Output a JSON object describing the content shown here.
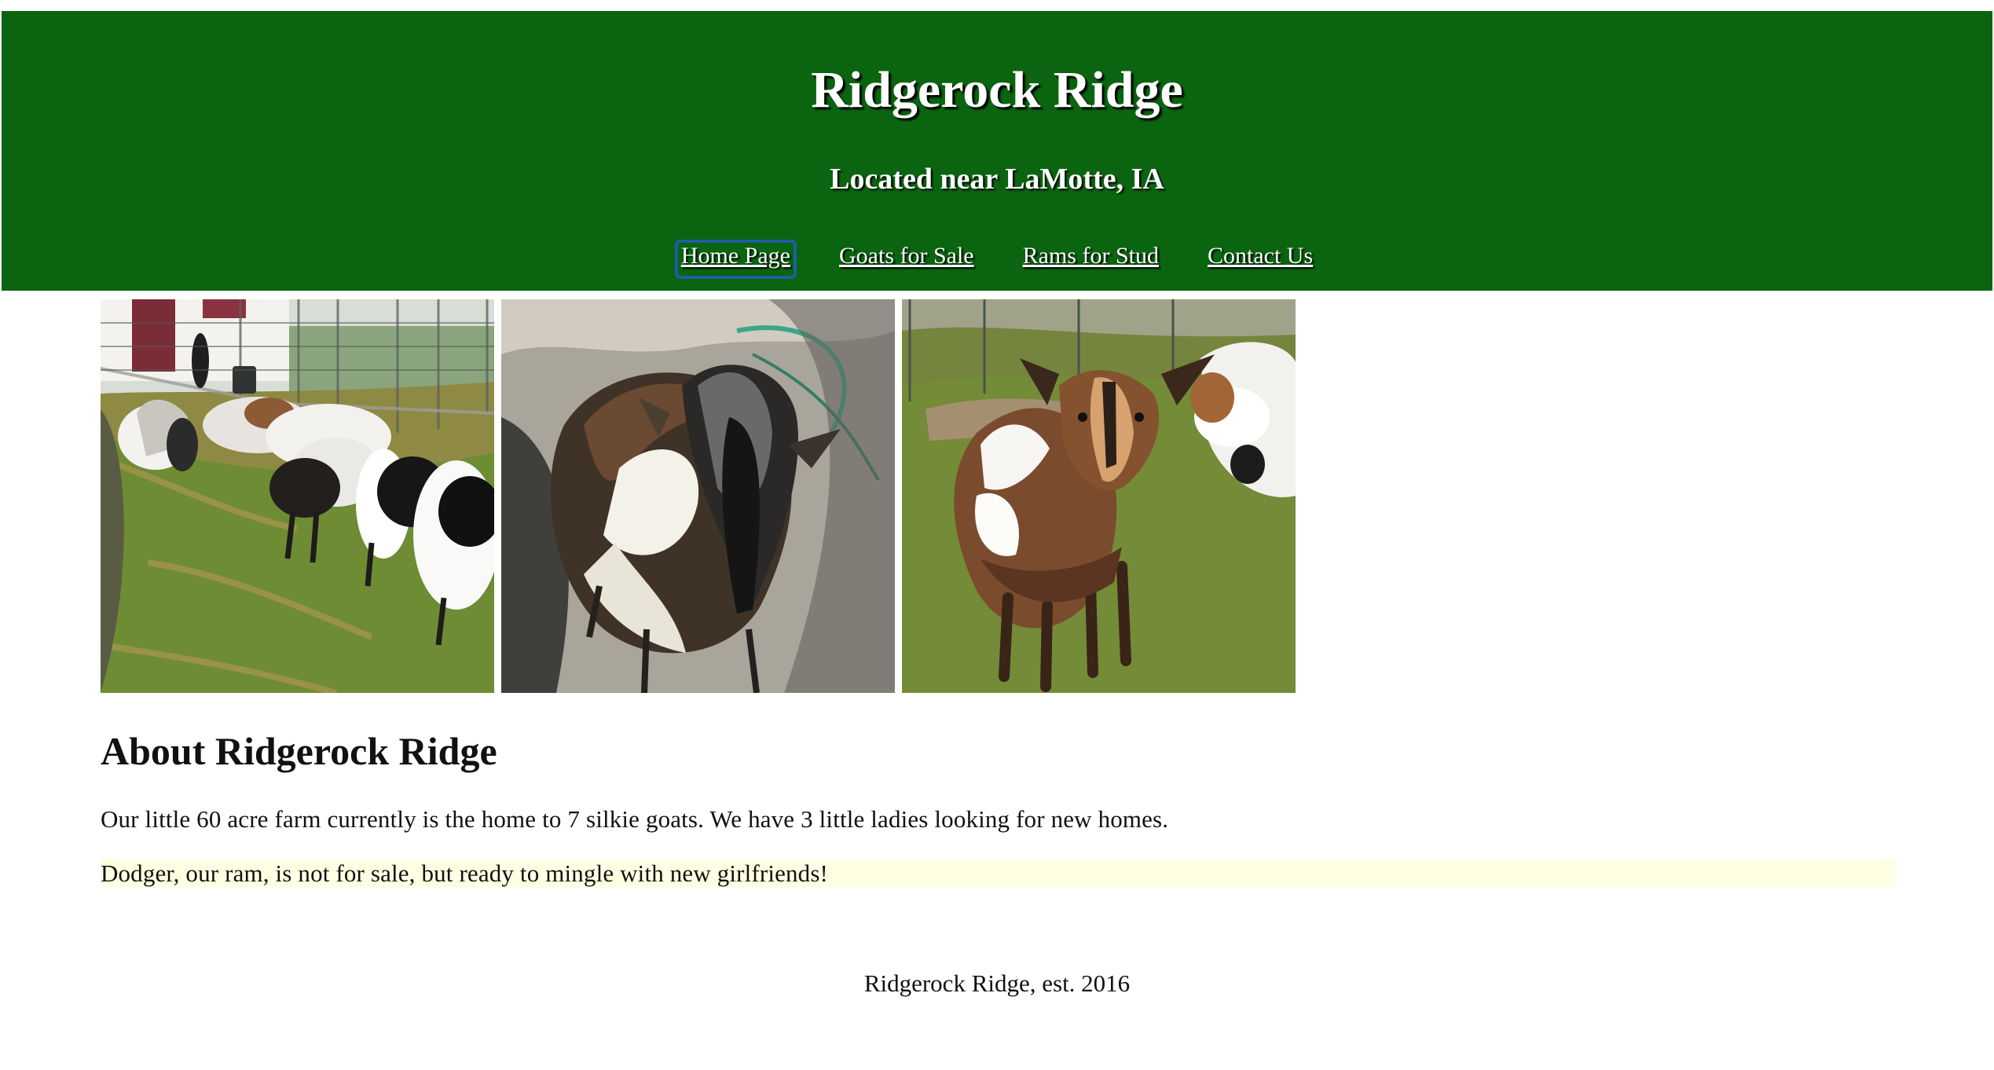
{
  "header": {
    "title": "Ridgerock Ridge",
    "subtitle": "Located near LaMotte, IA",
    "background_color": "#0b6410",
    "nav": [
      {
        "label": "Home Page",
        "active": true
      },
      {
        "label": "Goats for Sale",
        "active": false
      },
      {
        "label": "Rams for Stud",
        "active": false
      },
      {
        "label": "Contact Us",
        "active": false
      }
    ]
  },
  "gallery": {
    "images": [
      {
        "subject": "goat-herd-in-pen-photo"
      },
      {
        "subject": "long-haired-goat-photo"
      },
      {
        "subject": "brown-goat-on-grass-photo"
      }
    ]
  },
  "about": {
    "heading": "About Ridgerock Ridge",
    "intro": "Our little 60 acre farm currently is the home to 7 silkie goats. We have 3 little ladies looking for new homes.",
    "ram_note": "Dodger, our ram, is not for sale, but ready to mingle with new girlfriends!",
    "highlight_color": "#ffffe3"
  },
  "footer": {
    "text": "Ridgerock Ridge, est. 2016"
  }
}
